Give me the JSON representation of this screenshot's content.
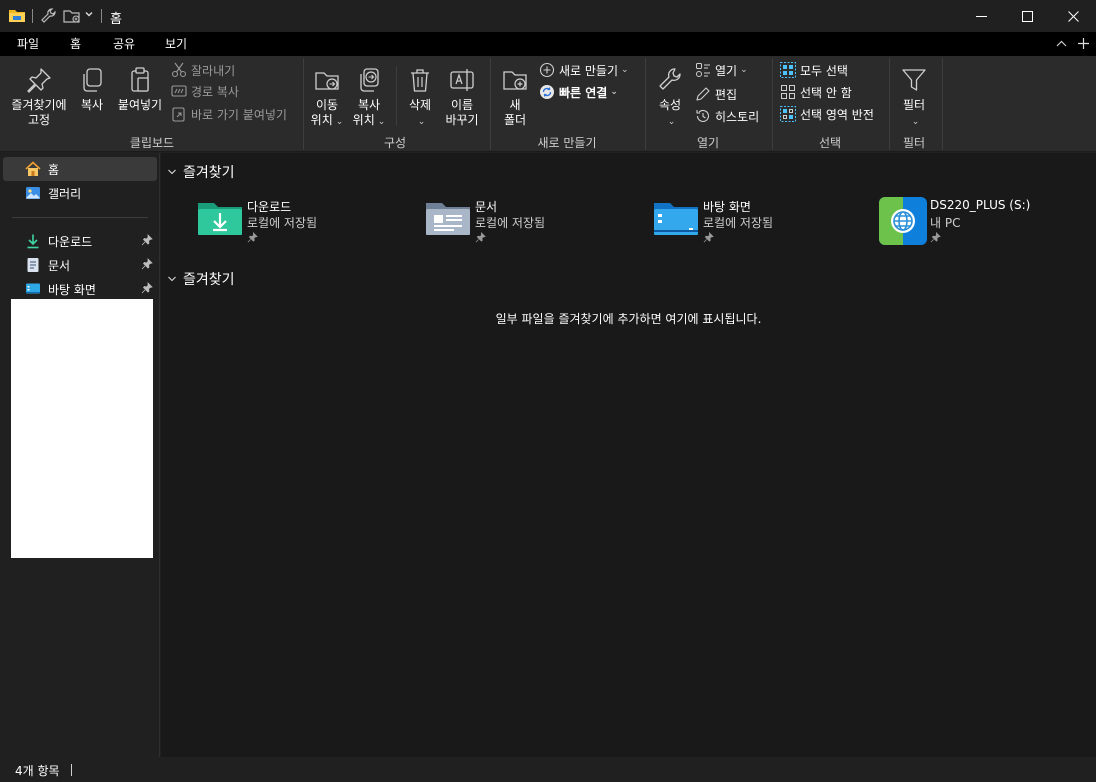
{
  "titlebar": {
    "title": "홈",
    "icons": [
      "folder-icon",
      "wrench-icon",
      "new-folder-icon",
      "chevron-down-icon"
    ]
  },
  "menu": {
    "tabs": [
      "파일",
      "홈",
      "공유",
      "보기"
    ],
    "active": "홈"
  },
  "ribbon": {
    "clipboard": {
      "label": "클립보드",
      "pin_line1": "즐겨찾기에",
      "pin_line2": "고정",
      "copy": "복사",
      "paste": "붙여넣기",
      "cut": "잘라내기",
      "copy_path": "경로 복사",
      "paste_shortcut": "바로 가기 붙여넣기"
    },
    "organize": {
      "label": "구성",
      "move_line1": "이동",
      "move_line2": "위치",
      "copyto_line1": "복사",
      "copyto_line2": "위치",
      "delete": "삭제",
      "rename_line1": "이름",
      "rename_line2": "바꾸기"
    },
    "new": {
      "label": "새로 만들기",
      "folder_line1": "새",
      "folder_line2": "폴더",
      "new_item": "새로 만들기",
      "quick_access": "빠른 연결"
    },
    "open": {
      "label": "열기",
      "properties": "속성",
      "open": "열기",
      "edit": "편집",
      "history": "히스토리"
    },
    "select": {
      "label": "선택",
      "select_all": "모두 선택",
      "select_none": "선택 안 함",
      "invert": "선택 영역 반전"
    },
    "filter": {
      "label": "필터",
      "button": "필터"
    }
  },
  "sidebar": {
    "items": [
      {
        "label": "홈",
        "icon": "home-icon",
        "selected": true
      },
      {
        "label": "갤러리",
        "icon": "gallery-icon"
      },
      {
        "label": "다운로드",
        "icon": "download-icon",
        "pinned": true
      },
      {
        "label": "문서",
        "icon": "document-icon",
        "pinned": true
      },
      {
        "label": "바탕 화면",
        "icon": "desktop-icon",
        "pinned": true
      }
    ]
  },
  "main": {
    "favorites_title": "즐겨찾기",
    "tiles": [
      {
        "name": "다운로드",
        "sub": "로컬에 저장됨",
        "icon": "downloads-folder-icon"
      },
      {
        "name": "문서",
        "sub": "로컬에 저장됨",
        "icon": "documents-folder-icon"
      },
      {
        "name": "바탕 화면",
        "sub": "로컬에 저장됨",
        "icon": "desktop-folder-icon"
      },
      {
        "name": "DS220_PLUS (S:)",
        "sub": "내 PC",
        "icon": "network-drive-icon"
      }
    ],
    "recent_title": "즐겨찾기",
    "empty_message": "일부 파일을 즐겨찾기에 추가하면 여기에 표시됩니다."
  },
  "status": {
    "count": "4개 항목"
  },
  "colors": {
    "accent": "#4cc2ff",
    "background": "#191919",
    "ribbon": "#2b2b2b"
  }
}
